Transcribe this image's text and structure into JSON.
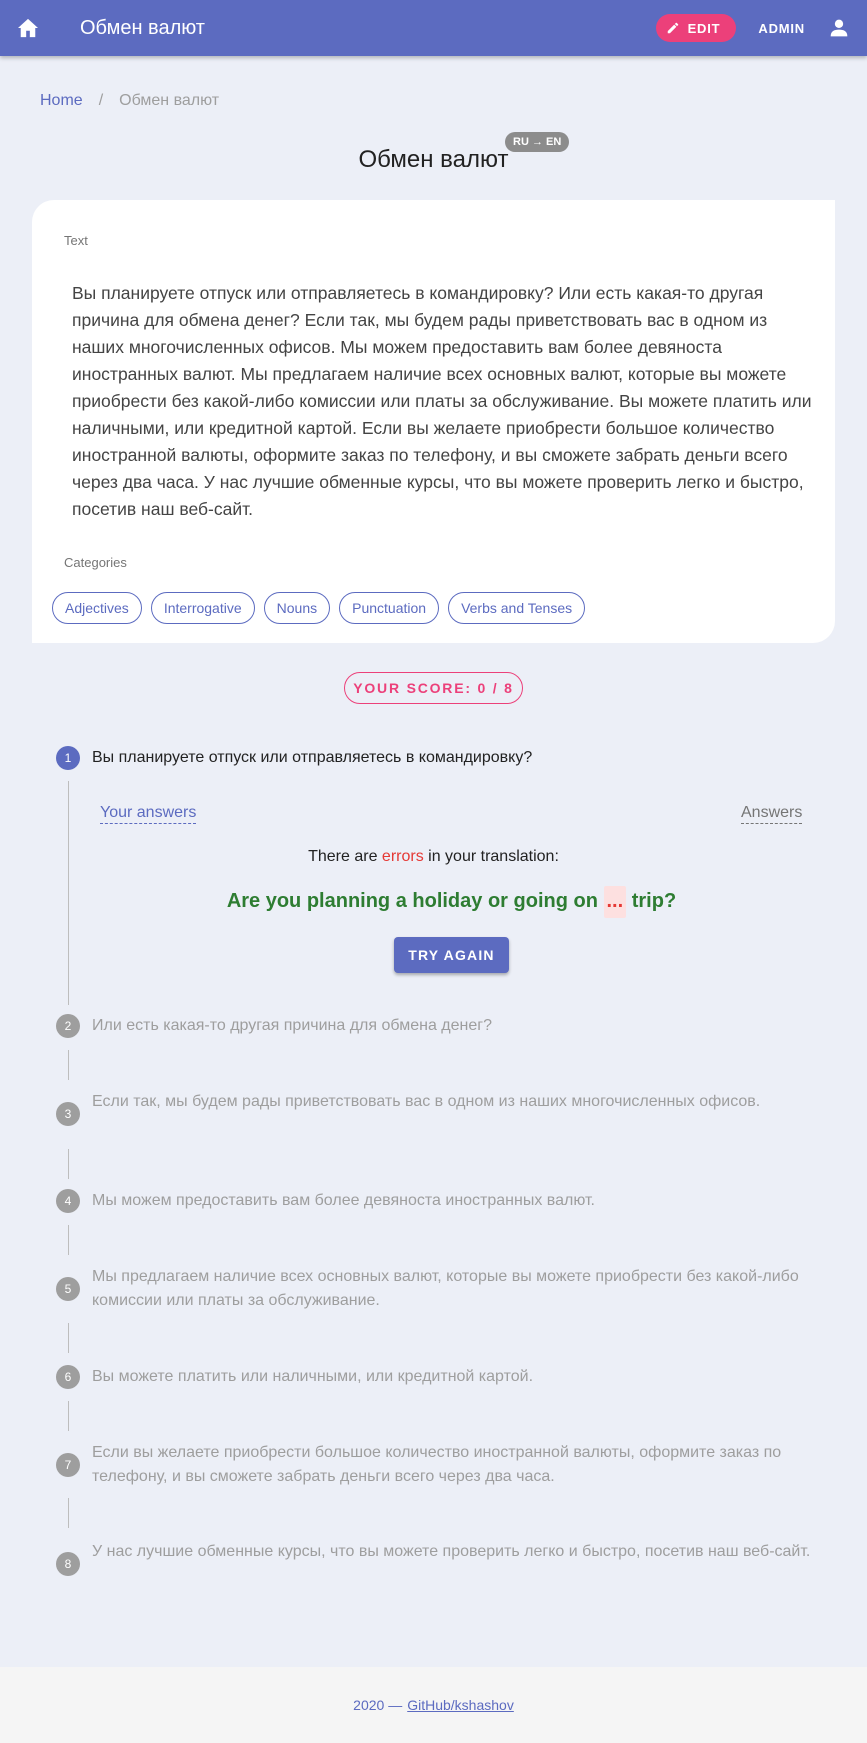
{
  "appbar": {
    "title": "Обмен валют",
    "edit_label": "EDIT",
    "admin_label": "ADMIN"
  },
  "breadcrumb": {
    "home": "Home",
    "separator": "/",
    "current": "Обмен валют"
  },
  "page": {
    "title": "Обмен валют",
    "lang_badge": "RU → EN"
  },
  "card": {
    "text_label": "Text",
    "text": "Вы планируете отпуск или отправляетесь в командировку? Или есть какая-то другая причина для обмена денег? Если так, мы будем рады приветствовать вас в одном из наших многочисленных офисов. Мы можем предоставить вам более девяноста иностранных валют. Мы предлагаем наличие всех основных валют, которые вы можете приобрести без какой-либо комиссии или платы за обслуживание. Вы можете платить или наличными, или кредитной картой. Если вы желаете приобрести большое количество иностранной валюты, оформите заказ по телефону, и вы сможете забрать деньги всего через два часа. У нас лучшие обменные курсы, что вы можете проверить легко и быстро, посетив наш веб-сайт.",
    "categories_label": "Categories",
    "categories": [
      "Adjectives",
      "Interrogative",
      "Nouns",
      "Punctuation",
      "Verbs and Tenses"
    ]
  },
  "score": {
    "label": "YOUR SCORE: 0 / 8"
  },
  "steps": [
    {
      "num": "1",
      "text": "Вы планируете отпуск или отправляетесь в командировку?"
    },
    {
      "num": "2",
      "text": "Или есть какая-то другая причина для обмена денег?"
    },
    {
      "num": "3",
      "text": "Если так, мы будем рады приветствовать вас в одном из наших многочисленных офисов."
    },
    {
      "num": "4",
      "text": "Мы можем предоставить вам более девяноста иностранных валют."
    },
    {
      "num": "5",
      "text": "Мы предлагаем наличие всех основных валют, которые вы можете приобрести без какой-либо комиссии или платы за обслуживание."
    },
    {
      "num": "6",
      "text": "Вы можете платить или наличными, или кредитной картой."
    },
    {
      "num": "7",
      "text": "Если вы желаете приобрести большое количество иностранной валюты, оформите заказ по телефону, и вы сможете забрать деньги всего через два часа."
    },
    {
      "num": "8",
      "text": "У нас лучшие обменные курсы, что вы можете проверить легко и быстро, посетив наш веб-сайт."
    }
  ],
  "active_step": {
    "tab_your_answers": "Your answers",
    "tab_answers": "Answers",
    "errors_prefix": "There are",
    "errors_word": "errors",
    "errors_suffix": "in your translation:",
    "translation_before": "Are you planning a holiday or going on",
    "translation_gap": "...",
    "translation_after": "trip?",
    "try_again_label": "TRY AGAIN"
  },
  "footer": {
    "prefix": "2020 —",
    "link": "GitHub/kshashov"
  },
  "colors": {
    "primary": "#5c6bc0",
    "accent": "#ec407a",
    "success": "#2e7d32",
    "error": "#e53935"
  },
  "icons": {
    "home": "home-icon",
    "edit": "pencil-icon",
    "user": "account-icon"
  }
}
